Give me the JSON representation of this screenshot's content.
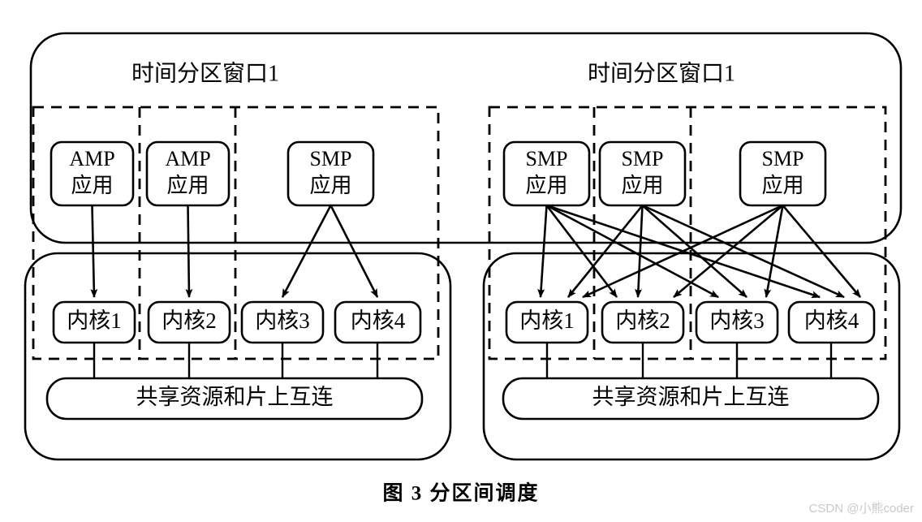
{
  "figure": {
    "caption": "图 3   分区间调度",
    "watermark": "CSDN @小熊coder",
    "background_color": "#ffffff",
    "line_color": "#000000"
  },
  "panels": [
    {
      "id": "left",
      "window_title": "时间分区窗口1",
      "apps": [
        {
          "latin": "AMP",
          "cn": "应用"
        },
        {
          "latin": "AMP",
          "cn": "应用"
        },
        {
          "latin": "SMP",
          "cn": "应用"
        }
      ],
      "cores": [
        "内核1",
        "内核2",
        "内核3",
        "内核4"
      ],
      "bus": "共享资源和片上互连"
    },
    {
      "id": "right",
      "window_title": "时间分区窗口1",
      "apps": [
        {
          "latin": "SMP",
          "cn": "应用"
        },
        {
          "latin": "SMP",
          "cn": "应用"
        },
        {
          "latin": "SMP",
          "cn": "应用"
        }
      ],
      "cores": [
        "内核1",
        "内核2",
        "内核3",
        "内核4"
      ],
      "bus": "共享资源和片上互连"
    }
  ]
}
